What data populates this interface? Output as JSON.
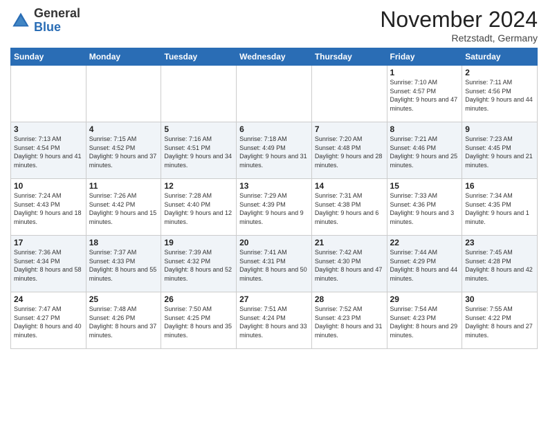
{
  "header": {
    "logo_general": "General",
    "logo_blue": "Blue",
    "month": "November 2024",
    "location": "Retzstadt, Germany"
  },
  "days_of_week": [
    "Sunday",
    "Monday",
    "Tuesday",
    "Wednesday",
    "Thursday",
    "Friday",
    "Saturday"
  ],
  "weeks": [
    [
      {
        "day": "",
        "info": ""
      },
      {
        "day": "",
        "info": ""
      },
      {
        "day": "",
        "info": ""
      },
      {
        "day": "",
        "info": ""
      },
      {
        "day": "",
        "info": ""
      },
      {
        "day": "1",
        "info": "Sunrise: 7:10 AM\nSunset: 4:57 PM\nDaylight: 9 hours and 47 minutes."
      },
      {
        "day": "2",
        "info": "Sunrise: 7:11 AM\nSunset: 4:56 PM\nDaylight: 9 hours and 44 minutes."
      }
    ],
    [
      {
        "day": "3",
        "info": "Sunrise: 7:13 AM\nSunset: 4:54 PM\nDaylight: 9 hours and 41 minutes."
      },
      {
        "day": "4",
        "info": "Sunrise: 7:15 AM\nSunset: 4:52 PM\nDaylight: 9 hours and 37 minutes."
      },
      {
        "day": "5",
        "info": "Sunrise: 7:16 AM\nSunset: 4:51 PM\nDaylight: 9 hours and 34 minutes."
      },
      {
        "day": "6",
        "info": "Sunrise: 7:18 AM\nSunset: 4:49 PM\nDaylight: 9 hours and 31 minutes."
      },
      {
        "day": "7",
        "info": "Sunrise: 7:20 AM\nSunset: 4:48 PM\nDaylight: 9 hours and 28 minutes."
      },
      {
        "day": "8",
        "info": "Sunrise: 7:21 AM\nSunset: 4:46 PM\nDaylight: 9 hours and 25 minutes."
      },
      {
        "day": "9",
        "info": "Sunrise: 7:23 AM\nSunset: 4:45 PM\nDaylight: 9 hours and 21 minutes."
      }
    ],
    [
      {
        "day": "10",
        "info": "Sunrise: 7:24 AM\nSunset: 4:43 PM\nDaylight: 9 hours and 18 minutes."
      },
      {
        "day": "11",
        "info": "Sunrise: 7:26 AM\nSunset: 4:42 PM\nDaylight: 9 hours and 15 minutes."
      },
      {
        "day": "12",
        "info": "Sunrise: 7:28 AM\nSunset: 4:40 PM\nDaylight: 9 hours and 12 minutes."
      },
      {
        "day": "13",
        "info": "Sunrise: 7:29 AM\nSunset: 4:39 PM\nDaylight: 9 hours and 9 minutes."
      },
      {
        "day": "14",
        "info": "Sunrise: 7:31 AM\nSunset: 4:38 PM\nDaylight: 9 hours and 6 minutes."
      },
      {
        "day": "15",
        "info": "Sunrise: 7:33 AM\nSunset: 4:36 PM\nDaylight: 9 hours and 3 minutes."
      },
      {
        "day": "16",
        "info": "Sunrise: 7:34 AM\nSunset: 4:35 PM\nDaylight: 9 hours and 1 minute."
      }
    ],
    [
      {
        "day": "17",
        "info": "Sunrise: 7:36 AM\nSunset: 4:34 PM\nDaylight: 8 hours and 58 minutes."
      },
      {
        "day": "18",
        "info": "Sunrise: 7:37 AM\nSunset: 4:33 PM\nDaylight: 8 hours and 55 minutes."
      },
      {
        "day": "19",
        "info": "Sunrise: 7:39 AM\nSunset: 4:32 PM\nDaylight: 8 hours and 52 minutes."
      },
      {
        "day": "20",
        "info": "Sunrise: 7:41 AM\nSunset: 4:31 PM\nDaylight: 8 hours and 50 minutes."
      },
      {
        "day": "21",
        "info": "Sunrise: 7:42 AM\nSunset: 4:30 PM\nDaylight: 8 hours and 47 minutes."
      },
      {
        "day": "22",
        "info": "Sunrise: 7:44 AM\nSunset: 4:29 PM\nDaylight: 8 hours and 44 minutes."
      },
      {
        "day": "23",
        "info": "Sunrise: 7:45 AM\nSunset: 4:28 PM\nDaylight: 8 hours and 42 minutes."
      }
    ],
    [
      {
        "day": "24",
        "info": "Sunrise: 7:47 AM\nSunset: 4:27 PM\nDaylight: 8 hours and 40 minutes."
      },
      {
        "day": "25",
        "info": "Sunrise: 7:48 AM\nSunset: 4:26 PM\nDaylight: 8 hours and 37 minutes."
      },
      {
        "day": "26",
        "info": "Sunrise: 7:50 AM\nSunset: 4:25 PM\nDaylight: 8 hours and 35 minutes."
      },
      {
        "day": "27",
        "info": "Sunrise: 7:51 AM\nSunset: 4:24 PM\nDaylight: 8 hours and 33 minutes."
      },
      {
        "day": "28",
        "info": "Sunrise: 7:52 AM\nSunset: 4:23 PM\nDaylight: 8 hours and 31 minutes."
      },
      {
        "day": "29",
        "info": "Sunrise: 7:54 AM\nSunset: 4:23 PM\nDaylight: 8 hours and 29 minutes."
      },
      {
        "day": "30",
        "info": "Sunrise: 7:55 AM\nSunset: 4:22 PM\nDaylight: 8 hours and 27 minutes."
      }
    ]
  ]
}
